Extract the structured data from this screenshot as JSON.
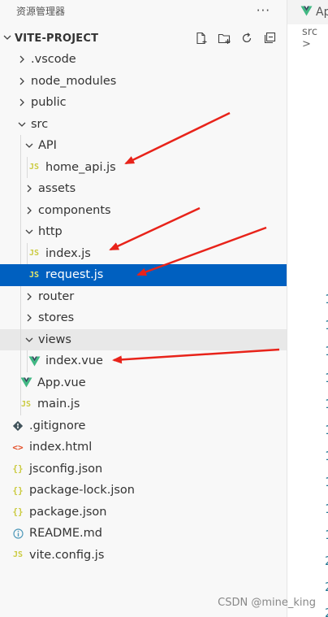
{
  "explorer": {
    "title": "资源管理器",
    "more_label": "···"
  },
  "project": {
    "name": "VITE-PROJECT"
  },
  "tree": [
    {
      "label": ".vscode"
    },
    {
      "label": "node_modules"
    },
    {
      "label": "public"
    },
    {
      "label": "src"
    },
    {
      "label": "API"
    },
    {
      "label": "home_api.js"
    },
    {
      "label": "assets"
    },
    {
      "label": "components"
    },
    {
      "label": "http"
    },
    {
      "label": "index.js"
    },
    {
      "label": "request.js"
    },
    {
      "label": "router"
    },
    {
      "label": "stores"
    },
    {
      "label": "views"
    },
    {
      "label": "index.vue"
    },
    {
      "label": "App.vue"
    },
    {
      "label": "main.js"
    },
    {
      "label": ".gitignore"
    },
    {
      "label": "index.html"
    },
    {
      "label": "jsconfig.json"
    },
    {
      "label": "package-lock.json"
    },
    {
      "label": "package.json"
    },
    {
      "label": "README.md"
    },
    {
      "label": "vite.config.js"
    }
  ],
  "icons": {
    "js": "JS",
    "json": "{}",
    "html": "<>"
  },
  "editor": {
    "tab_label": "Ap",
    "breadcrumb": "src >",
    "line_numbers": [
      "1",
      "1",
      "1",
      "1",
      "1",
      "1",
      "1",
      "1",
      "1",
      "1",
      "2",
      "2",
      "2"
    ]
  },
  "colors": {
    "selection": "#0060c0",
    "arrow": "#e8231a",
    "vue": "#41b883",
    "js": "#cbcb41"
  },
  "watermark": "CSDN @mine_king"
}
